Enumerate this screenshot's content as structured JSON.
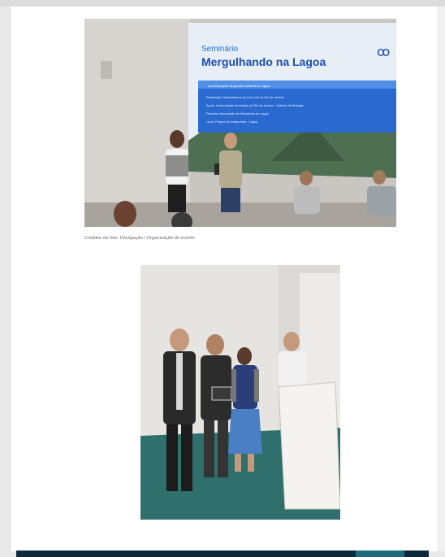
{
  "article": {
    "photo1": {
      "slide_title_small": "Seminário",
      "slide_title_large": "Mergulhando na Lagoa",
      "slide_logo": "ꝏ",
      "slide_subtitle": "A participação da gestão costeira de Lagoa",
      "slide_lines": [
        "Realização: Subprefeitura da Zona Sul de Rio de Janeiro",
        "Apoio: Universidade do Estado do Rio de Janeiro - Instituto de Biologia",
        "Parceria: Associação de Moradores da Lagoa",
        "Local: Parque da Catacumba - Lagoa"
      ]
    },
    "caption": "Créditos da foto: Divulgação / Organização do evento",
    "photo2": {}
  },
  "colors": {
    "page_bg": "#ffffff",
    "slide_blue": "#1e6fd9",
    "slide_bar": "#2a6ad0",
    "stage_teal": "#2f6f6c",
    "bottom_band": "#0d2a3d"
  }
}
